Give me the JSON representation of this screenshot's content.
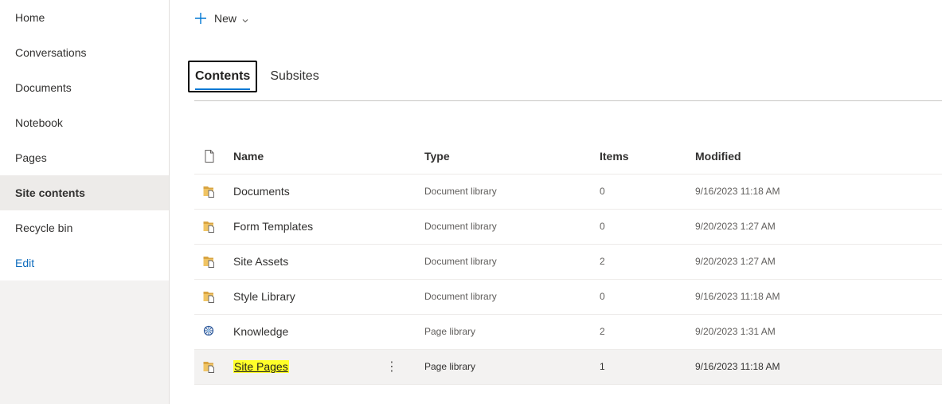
{
  "nav": {
    "items": [
      {
        "label": "Home"
      },
      {
        "label": "Conversations"
      },
      {
        "label": "Documents"
      },
      {
        "label": "Notebook"
      },
      {
        "label": "Pages"
      },
      {
        "label": "Site contents",
        "selected": true
      },
      {
        "label": "Recycle bin"
      },
      {
        "label": "Edit",
        "is_link": true
      }
    ]
  },
  "command_bar": {
    "new_label": "New",
    "icons": [
      "plus-icon",
      "chevron-down-icon"
    ]
  },
  "tabs": [
    {
      "label": "Contents",
      "active": true
    },
    {
      "label": "Subsites",
      "active": false
    }
  ],
  "table": {
    "columns": {
      "name": "Name",
      "type": "Type",
      "items": "Items",
      "modified": "Modified"
    },
    "rows": [
      {
        "name": "Documents",
        "type": "Document library",
        "items": "0",
        "modified": "9/16/2023 11:18 AM",
        "icon": "document-library-icon"
      },
      {
        "name": "Form Templates",
        "type": "Document library",
        "items": "0",
        "modified": "9/20/2023 1:27 AM",
        "icon": "document-library-icon"
      },
      {
        "name": "Site Assets",
        "type": "Document library",
        "items": "2",
        "modified": "9/20/2023 1:27 AM",
        "icon": "document-library-icon"
      },
      {
        "name": "Style Library",
        "type": "Document library",
        "items": "0",
        "modified": "9/16/2023 11:18 AM",
        "icon": "document-library-icon"
      },
      {
        "name": "Knowledge",
        "type": "Page library",
        "items": "2",
        "modified": "9/20/2023 1:31 AM",
        "icon": "page-library-icon"
      },
      {
        "name": "Site Pages",
        "type": "Page library",
        "items": "1",
        "modified": "9/16/2023 11:18 AM",
        "icon": "document-library-icon",
        "highlighted": true
      }
    ]
  },
  "colors": {
    "accent": "#0078d4",
    "highlight": "#ffff29",
    "nav_bg": "#f3f2f1"
  }
}
